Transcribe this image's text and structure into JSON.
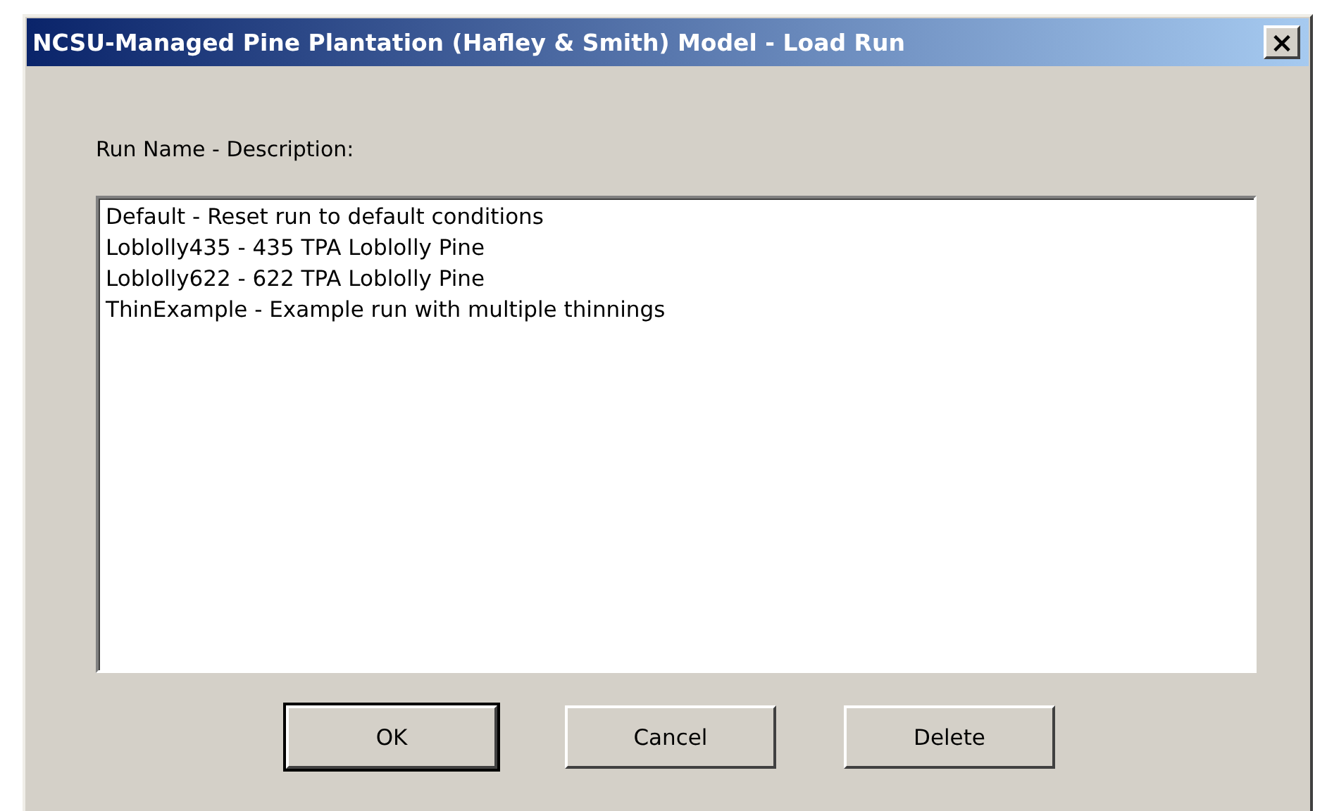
{
  "window": {
    "title": "NCSU-Managed Pine Plantation (Hafley & Smith) Model - Load Run",
    "close": "×"
  },
  "list_label": "Run Name - Description:",
  "runs": [
    {
      "text": "Default - Reset run to default conditions",
      "selected": false
    },
    {
      "text": "Loblolly435 - 435 TPA Loblolly Pine",
      "selected": false
    },
    {
      "text": "Loblolly622 - 622 TPA Loblolly Pine",
      "selected": false
    },
    {
      "text": "ThinExample - Example run with multiple thinnings",
      "selected": false
    }
  ],
  "buttons": [
    {
      "label": "OK",
      "default": true
    },
    {
      "label": "Cancel",
      "default": false
    },
    {
      "label": "Delete",
      "default": false
    }
  ]
}
